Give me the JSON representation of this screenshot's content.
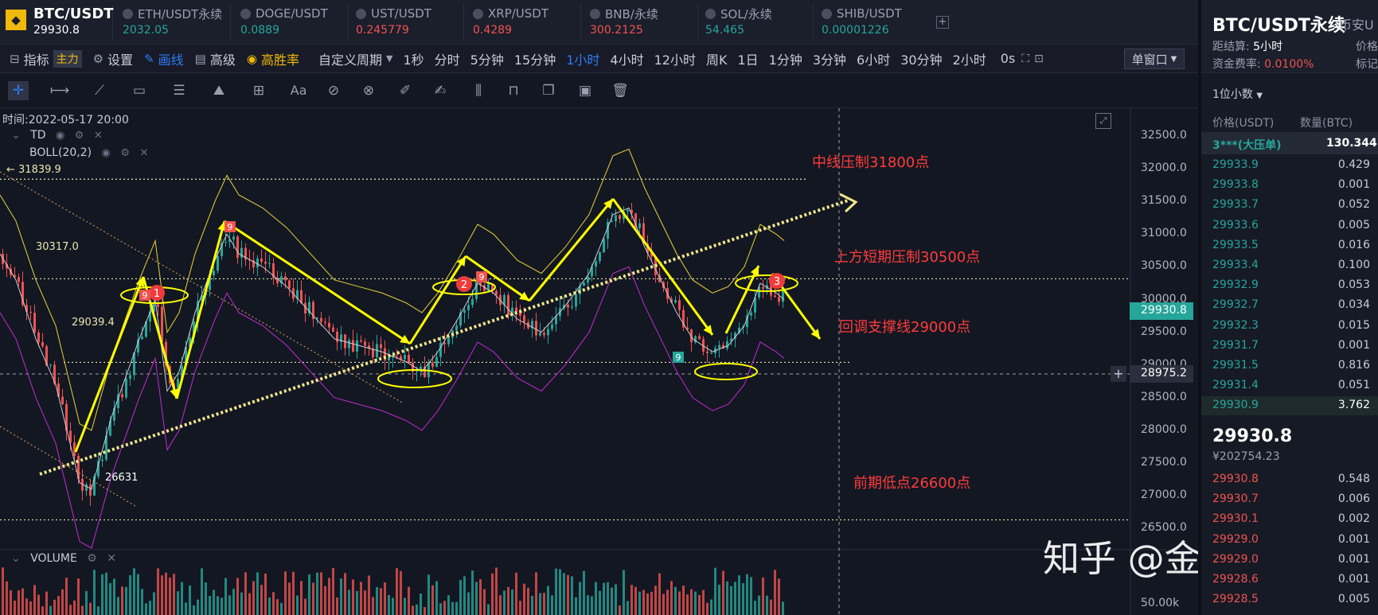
{
  "tickers": [
    {
      "name": "BTC/USDT",
      "price": "29930.8",
      "color": "#ffffff",
      "main": true
    },
    {
      "name": "ETH/USDT永续",
      "price": "2032.05",
      "color": "#26a69a"
    },
    {
      "name": "DOGE/USDT",
      "price": "0.0889",
      "color": "#26a69a"
    },
    {
      "name": "UST/USDT",
      "price": "0.245779",
      "color": "#ef5350"
    },
    {
      "name": "XRP/USDT",
      "price": "0.4289",
      "color": "#ef5350"
    },
    {
      "name": "BNB/永续",
      "price": "300.2125",
      "color": "#ef5350"
    },
    {
      "name": "SOL/永续",
      "price": "54.465",
      "color": "#26a69a"
    },
    {
      "name": "SHIB/USDT",
      "price": "0.00001226",
      "color": "#26a69a"
    }
  ],
  "toolbar": {
    "indicator": "指标",
    "indicator_badge": "主力",
    "settings": "设置",
    "draw": "画线",
    "advanced": "高级",
    "winrate": "高胜率",
    "custom_period": "自定义周期",
    "timeframes": [
      "1秒",
      "分时",
      "5分钟",
      "15分钟",
      "1小时",
      "4小时",
      "12小时",
      "周K",
      "1日",
      "1分钟",
      "3分钟",
      "6小时",
      "30分钟",
      "2小时",
      "0s"
    ],
    "active_timeframe": "1小时",
    "window_mode": "单窗口"
  },
  "chart": {
    "time_label": "时间:2022-05-17 20:00",
    "indicator_td": "TD",
    "indicator_boll": "BOLL(20,2)",
    "volume_label": "VOLUME",
    "y_ticks": [
      "32500.0",
      "32000.0",
      "31500.0",
      "31000.0",
      "30500.0",
      "30000.0",
      "29500.0",
      "29000.0",
      "28500.0",
      "28000.0",
      "27500.0",
      "27000.0",
      "26500.0"
    ],
    "current_price": "29930.8",
    "crosshair_price": "28975.2",
    "volume_tick": "50.00k",
    "levels": {
      "high": "31839.9",
      "mid": "30317.0",
      "low_mark": "29039.4",
      "bottom": "26631"
    },
    "annotations": {
      "resistance_mid": "中线压制31800点",
      "resistance_short": "上方短期压制30500点",
      "support": "回调支撑线29000点",
      "prior_low": "前期低点26600点"
    },
    "markers": [
      "1",
      "2",
      "3"
    ],
    "td_counts": [
      "9",
      "9",
      "9",
      "9"
    ],
    "watermark": "知乎 @金玲谈币",
    "colors": {
      "up": "#26a69a",
      "down": "#ef5350",
      "accent": "#2f7cf6",
      "arrow": "#ffff00"
    }
  },
  "orderbook": {
    "symbol": "BTC/USDT永续",
    "exchange": "币安U",
    "settle_label": "距结算:",
    "settle_value": "5小时",
    "funding_label": "资金费率:",
    "funding_value": "0.0100%",
    "side_label_1": "价格",
    "side_label_2": "标记",
    "precision": "1位小数",
    "col_price": "价格(USDT)",
    "col_qty": "数量(BTC)",
    "big_order_label": "3***(大压单)",
    "big_order_qty": "130.344",
    "bids_top": [
      {
        "price": "29933.9",
        "qty": "0.429"
      },
      {
        "price": "29933.8",
        "qty": "0.001"
      },
      {
        "price": "29933.7",
        "qty": "0.052"
      },
      {
        "price": "29933.6",
        "qty": "0.005"
      },
      {
        "price": "29933.5",
        "qty": "0.016"
      },
      {
        "price": "29933.4",
        "qty": "0.100"
      },
      {
        "price": "29932.9",
        "qty": "0.053"
      },
      {
        "price": "29932.7",
        "qty": "0.034"
      },
      {
        "price": "29932.3",
        "qty": "0.015"
      },
      {
        "price": "29931.7",
        "qty": "0.001"
      },
      {
        "price": "29931.5",
        "qty": "0.816"
      },
      {
        "price": "29931.4",
        "qty": "0.051"
      },
      {
        "price": "29930.9",
        "qty": "3.762"
      }
    ],
    "last_price": "29930.8",
    "last_cny": "¥202754.23",
    "asks": [
      {
        "price": "29930.8",
        "qty": "0.548"
      },
      {
        "price": "29930.7",
        "qty": "0.006"
      },
      {
        "price": "29930.1",
        "qty": "0.002"
      },
      {
        "price": "29929.0",
        "qty": "0.001"
      },
      {
        "price": "29929.0",
        "qty": "0.001"
      },
      {
        "price": "29928.6",
        "qty": "0.001"
      },
      {
        "price": "29928.5",
        "qty": "0.005"
      }
    ]
  }
}
